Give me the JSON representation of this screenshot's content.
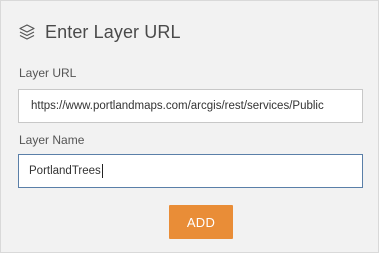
{
  "header": {
    "icon": "layers-icon",
    "title": "Enter Layer URL"
  },
  "form": {
    "url_label": "Layer URL",
    "url_value": "https://www.portlandmaps.com/arcgis/rest/services/Public",
    "name_label": "Layer Name",
    "name_value": "PortlandTrees"
  },
  "actions": {
    "add_label": "ADD"
  },
  "colors": {
    "panel_background": "#f2f2f2",
    "button_accent": "#e98d37",
    "focused_border": "#5a7fa8"
  }
}
